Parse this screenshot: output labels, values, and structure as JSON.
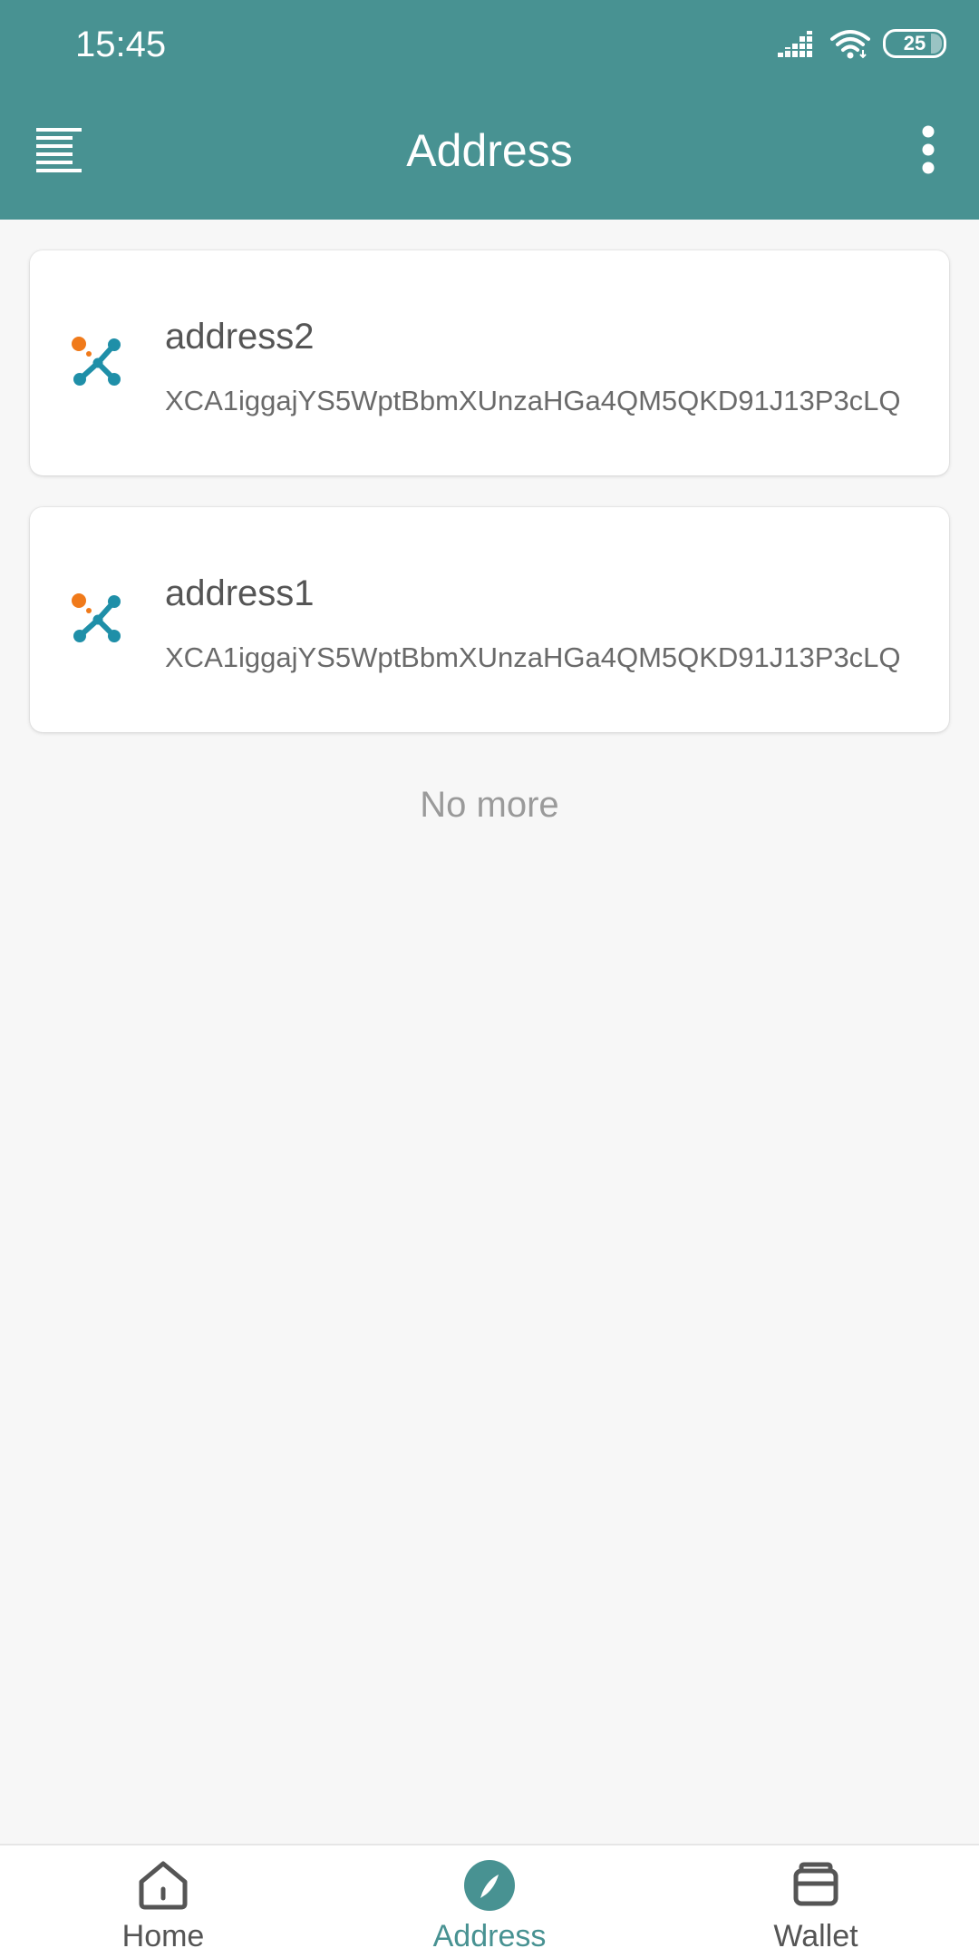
{
  "status_bar": {
    "time": "15:45",
    "battery": "25"
  },
  "app_bar": {
    "title": "Address",
    "menu_icon": "menu-lines-icon",
    "more_icon": "more-vertical-icon"
  },
  "addresses": [
    {
      "name": "address2",
      "address": "XCA1iggajYS5WptBbmXUnzaHGa4QM5QKD91J13P3cLQ"
    },
    {
      "name": "address1",
      "address": "XCA1iggajYS5WptBbmXUnzaHGa4QM5QKD91J13P3cLQ"
    }
  ],
  "list_footer": "No more",
  "bottom_nav": {
    "home": "Home",
    "address": "Address",
    "wallet": "Wallet",
    "active": "address"
  },
  "colors": {
    "primary": "#489292",
    "logo_orange": "#f07a1a",
    "logo_teal": "#1f8fa8"
  }
}
